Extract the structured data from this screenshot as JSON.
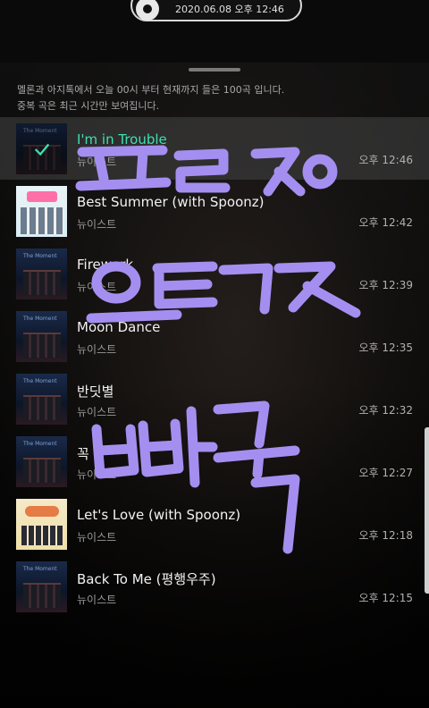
{
  "status_pill": {
    "time_text": "2020.06.08 오후 12:46"
  },
  "notice": {
    "line1": "멜론과 아지톡에서 오늘 00시 부터 현재까지 들은 100곡 입니다.",
    "line2": "중복 곡은 최근 시간만 보여집니다."
  },
  "accent_color": "#3de0b0",
  "graffiti_color": "#a48ff0",
  "tracks": [
    {
      "title": "I'm in Trouble",
      "artist": "뉴이스트",
      "time": "오후 12:46",
      "art": "night",
      "playing": true
    },
    {
      "title": "Best Summer (with Spoonz)",
      "artist": "뉴이스트",
      "time": "오후 12:42",
      "art": "summer"
    },
    {
      "title": "Firework",
      "artist": "뉴이스트",
      "time": "오후 12:39",
      "art": "night"
    },
    {
      "title": "Moon Dance",
      "artist": "뉴이스트",
      "time": "오후 12:35",
      "art": "night"
    },
    {
      "title": "반딧별",
      "artist": "뉴이스트",
      "time": "오후 12:32",
      "art": "night"
    },
    {
      "title": "꼭",
      "artist": "뉴이스트",
      "time": "오후 12:27",
      "art": "night"
    },
    {
      "title": "Let's Love (with Spoonz)",
      "artist": "뉴이스트",
      "time": "오후 12:18",
      "art": "love"
    },
    {
      "title": "Back To Me (평행우주)",
      "artist": "뉴이스트",
      "time": "오후 12:15",
      "art": "night"
    }
  ]
}
